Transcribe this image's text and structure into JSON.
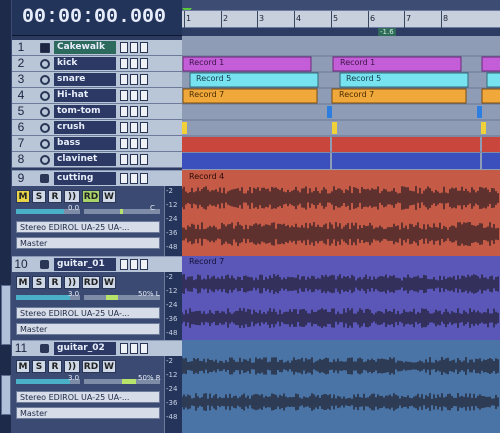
{
  "clock": "00:00:00.000",
  "ruler": {
    "ticks": [
      "1",
      "2",
      "3",
      "4",
      "5",
      "6",
      "7",
      "8"
    ]
  },
  "marker_label": "-1.6",
  "tracks": [
    {
      "number": "1",
      "name": "Cakewalk"
    },
    {
      "number": "2",
      "name": "kick"
    },
    {
      "number": "3",
      "name": "snare"
    },
    {
      "number": "4",
      "name": "Hi-hat"
    },
    {
      "number": "5",
      "name": "tom-tom"
    },
    {
      "number": "6",
      "name": "crush"
    },
    {
      "number": "7",
      "name": "bass"
    },
    {
      "number": "8",
      "name": "clavinet"
    }
  ],
  "audio_tracks": [
    {
      "number": "9",
      "name": "cutting",
      "volume": "0.0",
      "pan": "C",
      "input": "Stereo EDIROL UA-25 UA-...",
      "output": "Master",
      "clip": "Record 4"
    },
    {
      "number": "10",
      "name": "guitar_01",
      "volume": "3.0",
      "pan": "50% L",
      "input": "Stereo EDIROL UA-25 UA-...",
      "output": "Master",
      "clip": "Record 7"
    },
    {
      "number": "11",
      "name": "guitar_02",
      "volume": "3.0",
      "pan": "50% R",
      "input": "Stereo EDIROL UA-25 UA-...",
      "output": "Master",
      "clip": ""
    }
  ],
  "buttons": {
    "mute": "M",
    "solo": "S",
    "record": "R",
    "echo": "))",
    "rd": "RD",
    "write": "W"
  },
  "meter_labels": [
    "-2",
    "-12",
    "-24",
    "-36",
    "-48"
  ],
  "clips": [
    {
      "label": "Record 1"
    },
    {
      "label": "Record 1"
    },
    {
      "label": "Record 5"
    },
    {
      "label": "Record 5"
    },
    {
      "label": "Record 7"
    },
    {
      "label": "Record 7"
    }
  ],
  "colors": {
    "magenta": "#c35dd8",
    "cyan": "#78e3f0",
    "orange": "#f0a83a",
    "red": "#c8463b",
    "blue": "#3b4fbd",
    "salmon": "#c55a46",
    "purple": "#5a57b8",
    "steel": "#4b74a6"
  }
}
